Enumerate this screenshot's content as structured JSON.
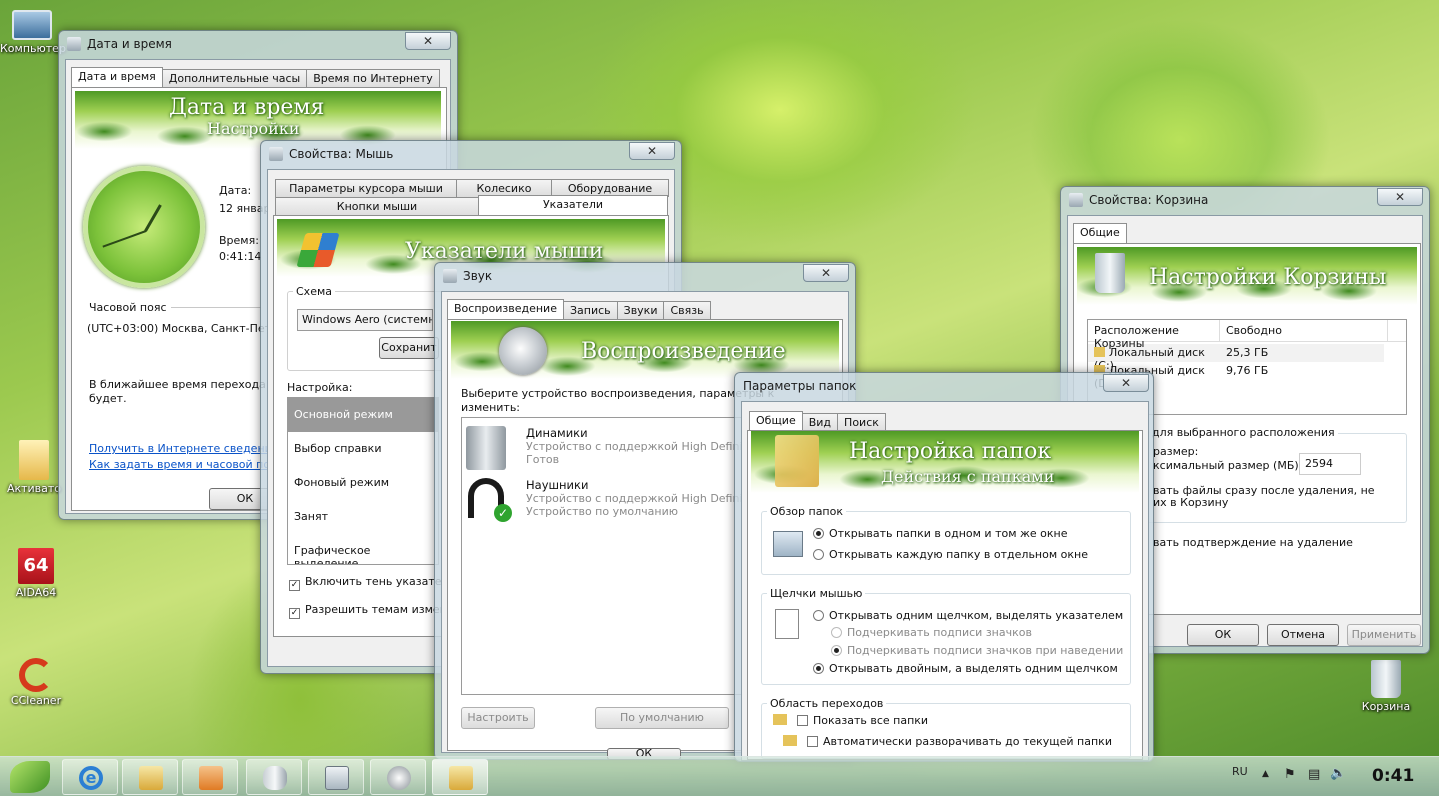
{
  "desktop": {
    "icons": [
      {
        "label": "Компьютер"
      },
      {
        "label": "Активато"
      },
      {
        "label": "AIDA64"
      },
      {
        "label": "CCleaner"
      },
      {
        "label": "Корзина"
      }
    ]
  },
  "datetime": {
    "title": "Дата и время",
    "tabs": [
      "Дата и время",
      "Дополнительные часы",
      "Время по Интернету"
    ],
    "banner_title": "Дата и время",
    "banner_sub": "Настройки",
    "date_label": "Дата:",
    "date_value": "12 январ",
    "time_label": "Время:",
    "time_value": "0:41:14",
    "tz_label": "Часовой пояс",
    "tz_value": "(UTC+03:00) Москва, Санкт-Петер",
    "dst_text1": "В ближайшее время перехода на",
    "dst_text2": "будет.",
    "link1": "Получить в Интернете сведения о",
    "link2": "Как задать время и часовой пояс",
    "ok": "ОК",
    "close": "✕"
  },
  "mouse": {
    "title": "Свойства: Мышь",
    "tabs_top": [
      "Параметры курсора мыши",
      "Колесико",
      "Оборудование"
    ],
    "tabs_bottom": [
      "Кнопки мыши",
      "Указатели"
    ],
    "banner_title": "Указатели мыши",
    "scheme_label": "Схема",
    "scheme_value": "Windows Aero (системная)",
    "save": "Сохранит",
    "setup_label": "Настройка:",
    "items": [
      "Основной режим",
      "Выбор справки",
      "Фоновый режим",
      "Занят",
      "Графическое выделение"
    ],
    "chk1": "Включить тень указателя",
    "chk2": "Разрешить темам измене",
    "close": "✕"
  },
  "sound": {
    "title": "Звук",
    "tabs": [
      "Воспроизведение",
      "Запись",
      "Звуки",
      "Связь"
    ],
    "banner_title": "Воспроизведение",
    "instr1": "Выберите устройство воспроизведения, параметры к",
    "instr2": "изменить:",
    "devices": [
      {
        "name": "Динамики",
        "desc": "Устройство с поддержкой High Definition",
        "status": "Готов"
      },
      {
        "name": "Наушники",
        "desc": "Устройство с поддержкой High Definition",
        "status": "Устройство по умолчанию"
      }
    ],
    "configure": "Настроить",
    "default": "По умолчанию",
    "ok": "ОК",
    "close": "✕"
  },
  "recycle": {
    "title": "Свойства: Корзина",
    "tabs": [
      "Общие"
    ],
    "banner_title": "Настройки Корзины",
    "col1": "Расположение Корзины",
    "col2": "Свободно",
    "rows": [
      {
        "loc": "Локальный диск (C:)",
        "free": "25,3 ГБ"
      },
      {
        "loc": "Локальный диск (D:)",
        "free": "9,76 ГБ"
      }
    ],
    "params_label": "для выбранного расположения",
    "size_label": "размер:",
    "max_label": "ксимальный размер (МБ):",
    "max_value": "2594",
    "delete_text1": "вать файлы сразу после удаления, не",
    "delete_text2": "их в Корзину",
    "confirm_text": "вать подтверждение на удаление",
    "ok": "ОК",
    "cancel": "Отмена",
    "apply": "Применить",
    "close": "✕"
  },
  "folder": {
    "title": "Параметры папок",
    "tabs": [
      "Общие",
      "Вид",
      "Поиск"
    ],
    "banner_title": "Настройка папок",
    "banner_sub": "Действия с папками",
    "browse_label": "Обзор папок",
    "browse_opt1": "Открывать папки в одном и том же окне",
    "browse_opt2": "Открывать каждую папку в отдельном окне",
    "click_label": "Щелчки мышью",
    "click_opt1": "Открывать одним щелчком, выделять указателем",
    "click_opt1a": "Подчеркивать подписи значков",
    "click_opt1b": "Подчеркивать подписи значков при наведении",
    "click_opt2": "Открывать двойным, а выделять одним щелчком",
    "nav_label": "Область переходов",
    "nav_opt1": "Показать все папки",
    "nav_opt2": "Автоматически разворачивать до текущей папки",
    "close": "✕"
  },
  "taskbar": {
    "lang": "RU",
    "clock": "0:41"
  }
}
